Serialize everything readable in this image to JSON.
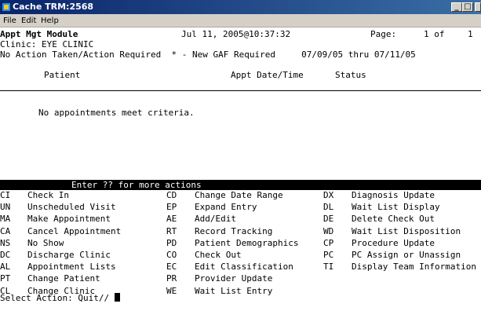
{
  "window": {
    "title": "Cache TRM:2568",
    "minimize_label": "_",
    "maximize_label": "□",
    "close_label": "×"
  },
  "menu": [
    "File",
    "Edit",
    "Help"
  ],
  "header": {
    "module": "Appt Mgt Module",
    "datetime": "Jul 11, 2005@10:37:32",
    "page_label": "Page:",
    "page_value": "1 of",
    "page_total": "1"
  },
  "clinic": "Clinic: EYE CLINIC",
  "filter_line": "No Action Taken/Action Required  * - New GAF Required     07/09/05 thru 07/11/05",
  "columns": {
    "patient": "Patient",
    "appt": "Appt Date/Time",
    "status": "Status"
  },
  "message": "No appointments meet criteria.",
  "actions_banner": "Enter ?? for more actions",
  "actions": [
    [
      "CI",
      "Check In",
      "CD",
      "Change Date Range",
      "DX",
      "Diagnosis Update"
    ],
    [
      "UN",
      "Unscheduled Visit",
      "EP",
      "Expand Entry",
      "DL",
      "Wait List Display"
    ],
    [
      "MA",
      "Make Appointment",
      "AE",
      "Add/Edit",
      "DE",
      "Delete Check Out"
    ],
    [
      "CA",
      "Cancel Appointment",
      "RT",
      "Record Tracking",
      "WD",
      "Wait List Disposition"
    ],
    [
      "NS",
      "No Show",
      "PD",
      "Patient Demographics",
      "CP",
      "Procedure Update"
    ],
    [
      "DC",
      "Discharge Clinic",
      "CO",
      "Check Out",
      "PC",
      "PC Assign or Unassign"
    ],
    [
      "AL",
      "Appointment Lists",
      "EC",
      "Edit Classification",
      "TI",
      "Display Team Information"
    ],
    [
      "PT",
      "Change Patient",
      "PR",
      "Provider Update",
      "",
      ""
    ],
    [
      "CL",
      "Change Clinic",
      "WE",
      "Wait List Entry",
      "",
      ""
    ]
  ],
  "prompt": "Select Action: Quit// ",
  "colors": {
    "titlebar": "#0a246a",
    "menubar": "#d4d0c8",
    "inverse_bg": "#000000"
  },
  "icons": {
    "app": "cache-terminal-icon"
  }
}
